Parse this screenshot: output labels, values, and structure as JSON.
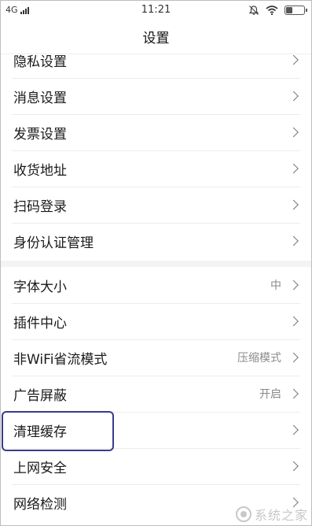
{
  "status_bar": {
    "network": "4G",
    "time": "11:21"
  },
  "header": {
    "title": "设置"
  },
  "groups": [
    {
      "items": [
        {
          "label": "隐私设置",
          "value": ""
        },
        {
          "label": "消息设置",
          "value": ""
        },
        {
          "label": "发票设置",
          "value": ""
        },
        {
          "label": "收货地址",
          "value": ""
        },
        {
          "label": "扫码登录",
          "value": ""
        },
        {
          "label": "身份认证管理",
          "value": ""
        }
      ]
    },
    {
      "items": [
        {
          "label": "字体大小",
          "value": "中"
        },
        {
          "label": "插件中心",
          "value": ""
        },
        {
          "label": "非WiFi省流模式",
          "value": "压缩模式"
        },
        {
          "label": "广告屏蔽",
          "value": "开启"
        },
        {
          "label": "清理缓存",
          "value": ""
        },
        {
          "label": "上网安全",
          "value": ""
        },
        {
          "label": "网络检测",
          "value": ""
        }
      ]
    }
  ],
  "watermark": {
    "text": "系统之家"
  }
}
